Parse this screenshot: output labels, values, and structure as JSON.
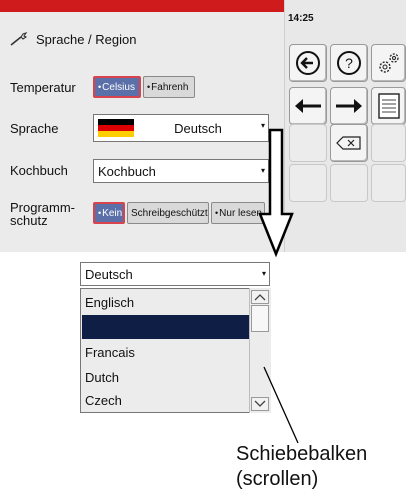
{
  "panel": {
    "title": "Sprache / Region",
    "temperature": {
      "label": "Temperatur",
      "options": [
        "Celsius",
        "Fahrenh"
      ],
      "selected": "Celsius"
    },
    "language": {
      "label": "Sprache",
      "value": "Deutsch"
    },
    "cookbook": {
      "label": "Kochbuch",
      "value": "Kochbuch"
    },
    "program_protection": {
      "label_line1": "Programm-",
      "label_line2": "schutz",
      "options": [
        "Kein",
        "Schreibgeschützt",
        "Nur lesen"
      ],
      "selected": "Kein"
    }
  },
  "status": {
    "time": "14:25"
  },
  "keypad": {
    "icons": [
      "back-circle-icon",
      "help-icon",
      "settings-gears-icon",
      "arrow-left-icon",
      "arrow-right-icon",
      "document-icon",
      "backspace-icon"
    ],
    "help_symbol": "?"
  },
  "dropdown": {
    "value": "Deutsch",
    "options": [
      "Englisch",
      "Deutsch",
      "Francais",
      "Dutch",
      "Czech"
    ],
    "selected": "Deutsch"
  },
  "callout": {
    "line1": "Schiebebalken",
    "line2": "(scrollen)"
  },
  "colors": {
    "accent_red": "#cf1b1b",
    "selected_blue": "#5b6fa8",
    "highlight_navy": "#0e1e44"
  }
}
